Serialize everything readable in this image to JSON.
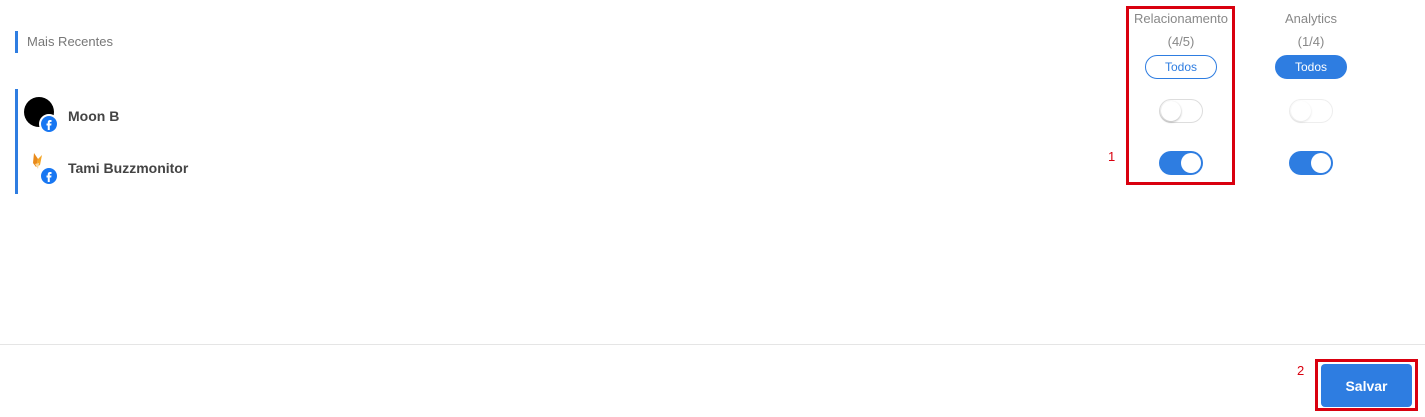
{
  "section": {
    "label": "Mais Recentes"
  },
  "profiles": [
    {
      "name": "Moon B",
      "network": "facebook"
    },
    {
      "name": "Tami Buzzmonitor",
      "network": "facebook"
    }
  ],
  "columns": [
    {
      "title": "Relacionamento",
      "count": "(4/5)",
      "button_label": "Todos",
      "button_style": "outline",
      "toggles": [
        false,
        true
      ]
    },
    {
      "title": "Analytics",
      "count": "(1/4)",
      "button_label": "Todos",
      "button_style": "filled",
      "toggles": [
        false,
        true
      ]
    }
  ],
  "annotations": {
    "marker_1": "1",
    "marker_2": "2"
  },
  "footer": {
    "save_label": "Salvar"
  },
  "colors": {
    "accent": "#2e7de1",
    "annotation": "#d9000f",
    "facebook": "#1877f2"
  }
}
